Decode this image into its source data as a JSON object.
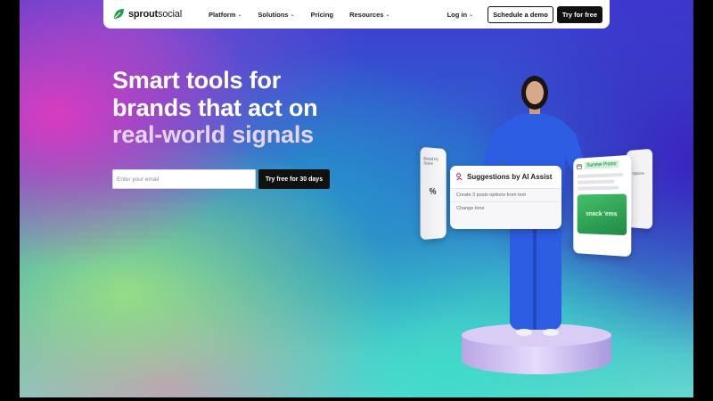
{
  "brand": {
    "name_bold": "sprout",
    "name_regular": "social",
    "accent": "#1f9f4a"
  },
  "nav": {
    "items": [
      {
        "label": "Platform",
        "has_dropdown": true
      },
      {
        "label": "Solutions",
        "has_dropdown": true
      },
      {
        "label": "Pricing",
        "has_dropdown": false
      },
      {
        "label": "Resources",
        "has_dropdown": true
      }
    ],
    "login_label": "Log in",
    "demo_button": "Schedule a demo",
    "trial_button": "Try for free"
  },
  "hero": {
    "headline_line1": "Smart tools for",
    "headline_line2": "brands that act on",
    "headline_line3": "real-world signals",
    "email_placeholder": "Enter your email",
    "cta_button": "Try free for 30 days"
  },
  "cards": {
    "left": {
      "title": "Brand Fit Score",
      "value": "%"
    },
    "assist": {
      "title": "Suggestions by AI Assist",
      "options": [
        "Create 3 posts options from text",
        "Change tone"
      ]
    },
    "promo": {
      "tag": "Summer Promo",
      "image_text": "snack 'ems"
    },
    "far": {
      "text": "Options"
    }
  },
  "colors": {
    "nav_bg": "#ffffff",
    "button_dark": "#111111",
    "headline_accent": "#e7d4f4"
  }
}
